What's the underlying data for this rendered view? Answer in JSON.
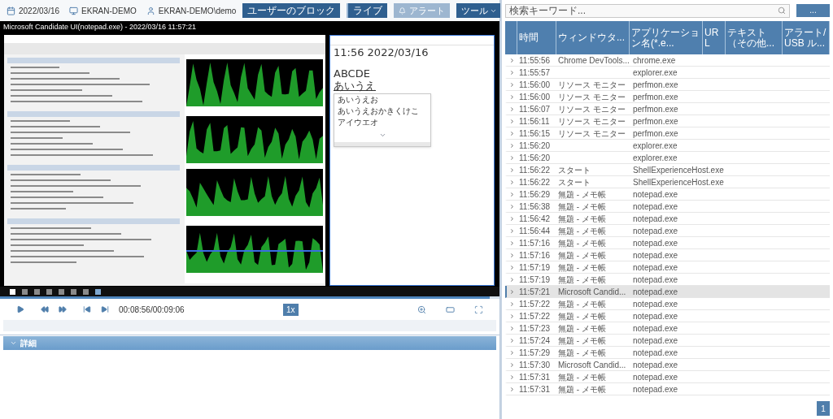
{
  "toolbar": {
    "date": "2022/03/16",
    "computer": "EKRAN-DEMO",
    "user": "EKRAN-DEMO\\demo",
    "buttons": [
      {
        "label": "ユーザーのブロック",
        "kind": "block"
      },
      {
        "label": "ライブ",
        "kind": "live"
      }
    ],
    "alert_button": {
      "label": "アラート",
      "disabled": true
    },
    "tools_button": {
      "label": "ツール"
    }
  },
  "player": {
    "title": "Microsoft Candidate UI(notepad.exe) - 2022/03/16 11:57:21",
    "notepad": {
      "lines": [
        "11:56 2022/03/16",
        "ABCDE"
      ],
      "composing": "あいうえ",
      "candidates": [
        "あいうえお",
        "あいうえおかきくけこ",
        "アイウエオ"
      ]
    },
    "progress": {
      "level": 0.98
    },
    "time": "00:08:56/00:09:06",
    "speed": "1x"
  },
  "details": {
    "label": "詳細",
    "expanded": true
  },
  "search": {
    "placeholder": "検索キーワード..."
  },
  "search_button": {
    "label": "..."
  },
  "table": {
    "columns": [
      "時間",
      "ウィンドウタ...",
      "アプリケーション名(*.e...",
      "URL",
      "テキスト（その他...",
      "アラート/USB ル..."
    ],
    "rows": [
      {
        "time": "11:55:56",
        "window": "Chrome DevTools...",
        "application": "chrome.exe",
        "selected": false
      },
      {
        "time": "11:55:57",
        "window": "",
        "application": "explorer.exe",
        "selected": false
      },
      {
        "time": "11:56:00",
        "window": "リソース モニター",
        "application": "perfmon.exe",
        "selected": false
      },
      {
        "time": "11:56:00",
        "window": "リソース モニター",
        "application": "perfmon.exe",
        "selected": false
      },
      {
        "time": "11:56:07",
        "window": "リソース モニター",
        "application": "perfmon.exe",
        "selected": false
      },
      {
        "time": "11:56:11",
        "window": "リソース モニター",
        "application": "perfmon.exe",
        "selected": false
      },
      {
        "time": "11:56:15",
        "window": "リソース モニター",
        "application": "perfmon.exe",
        "selected": false
      },
      {
        "time": "11:56:20",
        "window": "",
        "application": "explorer.exe",
        "selected": false
      },
      {
        "time": "11:56:20",
        "window": "",
        "application": "explorer.exe",
        "selected": false
      },
      {
        "time": "11:56:22",
        "window": "スタート",
        "application": "ShellExperienceHost.exe",
        "selected": false
      },
      {
        "time": "11:56:22",
        "window": "スタート",
        "application": "ShellExperienceHost.exe",
        "selected": false
      },
      {
        "time": "11:56:29",
        "window": "無題 - メモ帳",
        "application": "notepad.exe",
        "selected": false
      },
      {
        "time": "11:56:38",
        "window": "無題 - メモ帳",
        "application": "notepad.exe",
        "selected": false
      },
      {
        "time": "11:56:42",
        "window": "無題 - メモ帳",
        "application": "notepad.exe",
        "selected": false
      },
      {
        "time": "11:56:44",
        "window": "無題 - メモ帳",
        "application": "notepad.exe",
        "selected": false
      },
      {
        "time": "11:57:16",
        "window": "無題 - メモ帳",
        "application": "notepad.exe",
        "selected": false
      },
      {
        "time": "11:57:16",
        "window": "無題 - メモ帳",
        "application": "notepad.exe",
        "selected": false
      },
      {
        "time": "11:57:19",
        "window": "無題 - メモ帳",
        "application": "notepad.exe",
        "selected": false
      },
      {
        "time": "11:57:19",
        "window": "無題 - メモ帳",
        "application": "notepad.exe",
        "selected": false
      },
      {
        "time": "11:57:21",
        "window": "Microsoft Candid...",
        "application": "notepad.exe",
        "selected": true
      },
      {
        "time": "11:57:22",
        "window": "無題 - メモ帳",
        "application": "notepad.exe",
        "selected": false
      },
      {
        "time": "11:57:22",
        "window": "無題 - メモ帳",
        "application": "notepad.exe",
        "selected": false
      },
      {
        "time": "11:57:23",
        "window": "無題 - メモ帳",
        "application": "notepad.exe",
        "selected": false
      },
      {
        "time": "11:57:24",
        "window": "無題 - メモ帳",
        "application": "notepad.exe",
        "selected": false
      },
      {
        "time": "11:57:29",
        "window": "無題 - メモ帳",
        "application": "notepad.exe",
        "selected": false
      },
      {
        "time": "11:57:30",
        "window": "Microsoft Candid...",
        "application": "notepad.exe",
        "selected": false
      },
      {
        "time": "11:57:31",
        "window": "無題 - メモ帳",
        "application": "notepad.exe",
        "selected": false
      },
      {
        "time": "11:57:31",
        "window": "無題 - メモ帳",
        "application": "notepad.exe",
        "selected": false
      }
    ]
  },
  "pagination": [
    {
      "label": "1",
      "selected": true
    }
  ]
}
